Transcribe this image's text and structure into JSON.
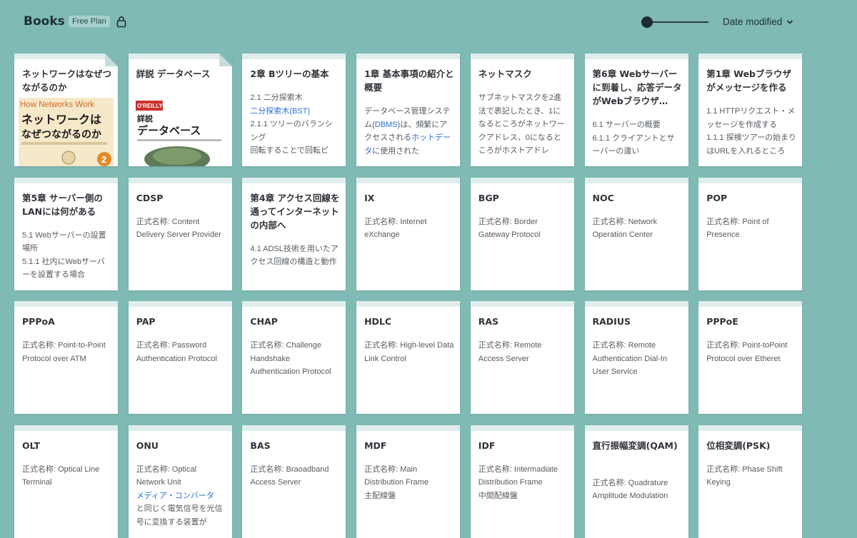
{
  "header": {
    "title": "Books",
    "plan": "Free Plan",
    "sort_label": "Date modified"
  },
  "cards": [
    {
      "title": "ネットワークはなぜつながるのか",
      "body": "",
      "cover": "network"
    },
    {
      "title": "詳説 データベース",
      "body": "",
      "cover": "database"
    },
    {
      "title": "2章 Bツリーの基本",
      "body_parts": [
        "2.1 二分探索木",
        "二分探索木(BST)",
        "2.1.1 ツリーのバランシング",
        "回転することで回転ピ"
      ]
    },
    {
      "title": "1章 基本事項の紹介と概要",
      "body_parts": [
        "データベース管理システム(",
        "DBMS",
        ")は、頻繁にアクセスされる",
        "ホットデータ",
        "に使用された"
      ]
    },
    {
      "title": "ネットマスク",
      "body": "サブネットマスクを2進法で表記したとき、1になるところがネットワークアドレス、0になるところがホストアドレ"
    },
    {
      "title": "第6章 Webサーバーに到着し、応答データがWebブラウザ…",
      "body": "6.1 サーバーの概要\n6.1.1 クライアントとサーバーの違い"
    },
    {
      "title": "第1章 Webブラウザがメッセージを作る",
      "body": "1.1 HTTPリクエスト・メッセージを作成する\n1.1.1 探検ツアーの始まりはURLを入れるところ"
    },
    {
      "title": "第5章 サーバー側のLANには何がある",
      "body": "5.1 Webサーバーの設置場所\n5.1.1 社内にWebサーバーを設置する場合"
    },
    {
      "title": "CDSP",
      "body": "正式名称: Content Delivery Server Provider"
    },
    {
      "title": "第4章 アクセス回線を通ってインターネットの内部へ",
      "body": "4.1 ADSL技術を用いたアクセス回線の構造と動作"
    },
    {
      "title": "IX",
      "body": "正式名称: Internet eXchange"
    },
    {
      "title": "BGP",
      "body": "正式名称: Border Gateway Protocol"
    },
    {
      "title": "NOC",
      "body": "正式名称: Network Operation Center"
    },
    {
      "title": "POP",
      "body": "正式名称: Point of Presence"
    },
    {
      "title": "PPPoA",
      "body": "正式名称: Point-to-Point Protocol over ATM"
    },
    {
      "title": "PAP",
      "body": "正式名称: Password Authentication Protocol"
    },
    {
      "title": "CHAP",
      "body": "正式名称: Challenge Handshake Authentication Protocol"
    },
    {
      "title": "HDLC",
      "body": "正式名称: High-level Data Link Control"
    },
    {
      "title": "RAS",
      "body": "正式名称: Remote Access Server"
    },
    {
      "title": "RADIUS",
      "body": "正式名称: Remote Authentication Dial-In User Service"
    },
    {
      "title": "PPPoE",
      "body": "正式名称: Point-toPoint Protocol over Etheret"
    },
    {
      "title": "OLT",
      "body": "正式名称: Optical Line Terminal"
    },
    {
      "title": "ONU",
      "body_parts": [
        "正式名称: Optical Network Unit",
        "メディア・コンバータ",
        "と同じく電気信号を光信号に変換する装置が"
      ]
    },
    {
      "title": "BAS",
      "body": "正式名称: Braoadband Access Server"
    },
    {
      "title": "MDF",
      "body": "正式名称: Main Distribution Frame\n主配線盤"
    },
    {
      "title": "IDF",
      "body": "正式名称: Intermadiate Distribution Frame\n中間配線盤"
    },
    {
      "title": "直行振幅変調(QAM)",
      "body": "正式名称: Quadrature Amplitude Modulation"
    },
    {
      "title": "位相変調(PSK)",
      "body": "正式名称: Phase Shift Keying"
    }
  ],
  "covers": {
    "network": {
      "line1": "How Networks Work",
      "line2": "ネットワークは",
      "line3": "なぜつながるのか"
    },
    "database": {
      "publisher": "O'REILLY",
      "line1": "詳説",
      "line2": "データベース"
    }
  },
  "colors": {
    "background": "#7fbab5",
    "link": "#2b6fd6"
  }
}
